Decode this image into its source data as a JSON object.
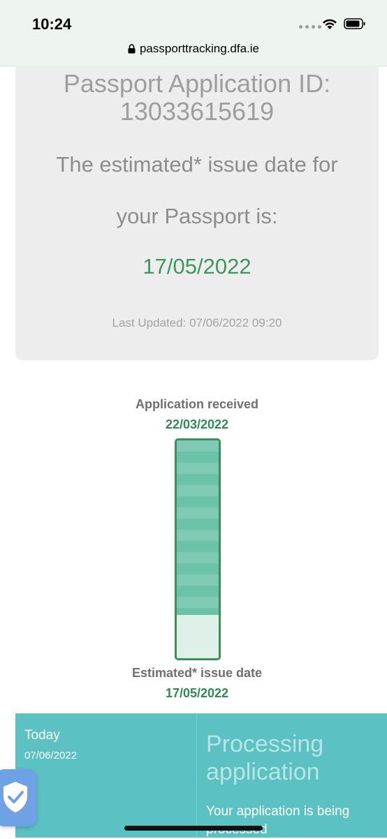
{
  "status_bar": {
    "time": "10:24",
    "url": "passporttracking.dfa.ie",
    "icons": [
      "signal-dots-icon",
      "wifi-icon",
      "battery-icon",
      "lock-icon"
    ]
  },
  "info_card": {
    "app_id_label": "Passport Application ID:",
    "app_id_value": "13033615619",
    "estimated_line1": "The estimated* issue date for",
    "estimated_line2": "your Passport is:",
    "estimated_date": "17/05/2022",
    "last_updated": "Last Updated: 07/06/2022 09:20"
  },
  "progress": {
    "received_label": "Application received",
    "received_date": "22/03/2022",
    "issue_label": "Estimated* issue date",
    "issue_date": "17/05/2022",
    "fill_fraction": 0.8
  },
  "timeline": {
    "today_label": "Today",
    "today_date": "07/06/2022",
    "processing_title": "Processing application",
    "processing_desc": "Your application is being processed"
  },
  "widgets": {
    "shield_icon": "shield-check-icon"
  },
  "colors": {
    "accent_green": "#2f8a53",
    "panel_teal": "#5cc1c2",
    "card_gray": "#ededed"
  }
}
